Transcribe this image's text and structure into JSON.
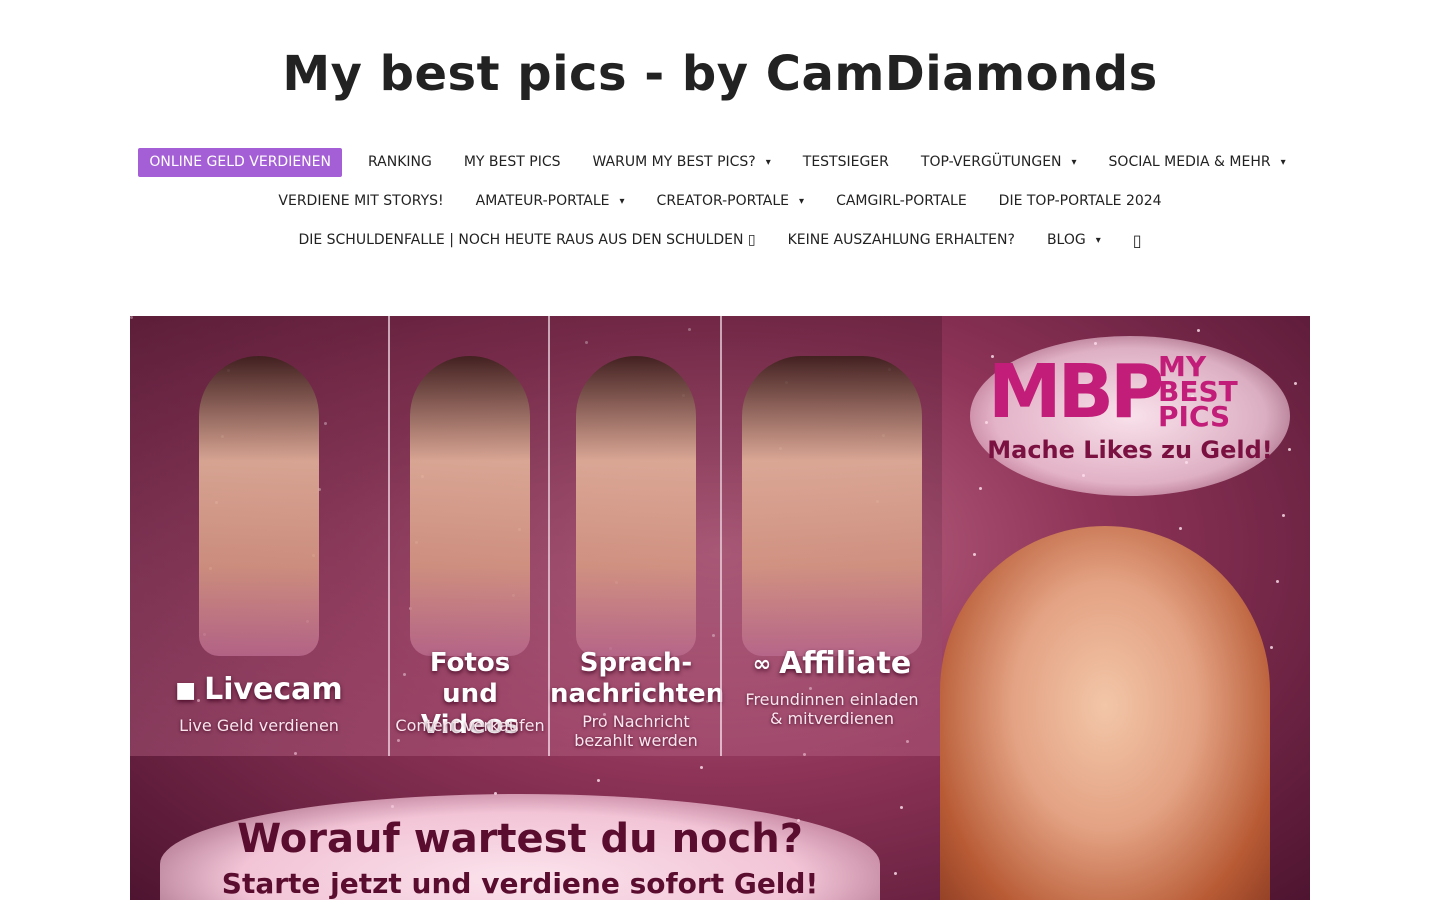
{
  "site": {
    "title": "My best pics - by CamDiamonds"
  },
  "nav": {
    "row1": [
      {
        "label": "ONLINE GELD VERDIENEN",
        "caret": false,
        "active": true
      },
      {
        "label": "RANKING",
        "caret": false
      },
      {
        "label": "MY BEST PICS",
        "caret": false
      },
      {
        "label": "WARUM MY BEST PICS?",
        "caret": true
      },
      {
        "label": "TESTSIEGER",
        "caret": false
      },
      {
        "label": "TOP-VERGÜTUNGEN",
        "caret": true
      },
      {
        "label": "SOCIAL MEDIA & MEHR",
        "caret": true
      }
    ],
    "row2": [
      {
        "label": "VERDIENE MIT STORYS!",
        "caret": false
      },
      {
        "label": "AMATEUR-PORTALE",
        "caret": true
      },
      {
        "label": "CREATOR-PORTALE",
        "caret": true
      },
      {
        "label": "CAMGIRL-PORTALE",
        "caret": false
      },
      {
        "label": "DIE TOP-PORTALE 2024",
        "caret": false
      }
    ],
    "row3": [
      {
        "label": "DIE SCHULDENFALLE | NOCH HEUTE RAUS AUS DEN SCHULDEN ▯",
        "caret": false
      },
      {
        "label": "KEINE AUSZAHLUNG ERHALTEN?",
        "caret": false
      },
      {
        "label": "BLOG",
        "caret": true
      }
    ],
    "caret_glyph": "▾",
    "search_glyph": "▯"
  },
  "hero": {
    "panels": [
      {
        "title": "Livecam",
        "subtitle": "Live Geld verdienen",
        "icon": "video-camera-icon",
        "icon_glyph": "■"
      },
      {
        "title": "Fotos\nund Videos",
        "subtitle": "Content verkaufen"
      },
      {
        "title": "Sprach-\nnachrichten",
        "subtitle": "Pro Nachricht\nbezahlt werden"
      },
      {
        "title": "Affiliate",
        "subtitle": "Freundinnen einladen\n& mitverdienen",
        "icon": "link-chain-icon",
        "icon_glyph": "∞"
      }
    ],
    "logo": {
      "mark": "MBP",
      "word1": "MY",
      "word2": "BEST",
      "word3": "PICS",
      "tagline": "Mache Likes zu Geld!"
    },
    "headline": "Worauf wartest du noch?",
    "subheadline": "Starte jetzt und verdiene sofort Geld!"
  },
  "colors": {
    "accent": "#a55fd6",
    "brand": "#c21d78"
  }
}
